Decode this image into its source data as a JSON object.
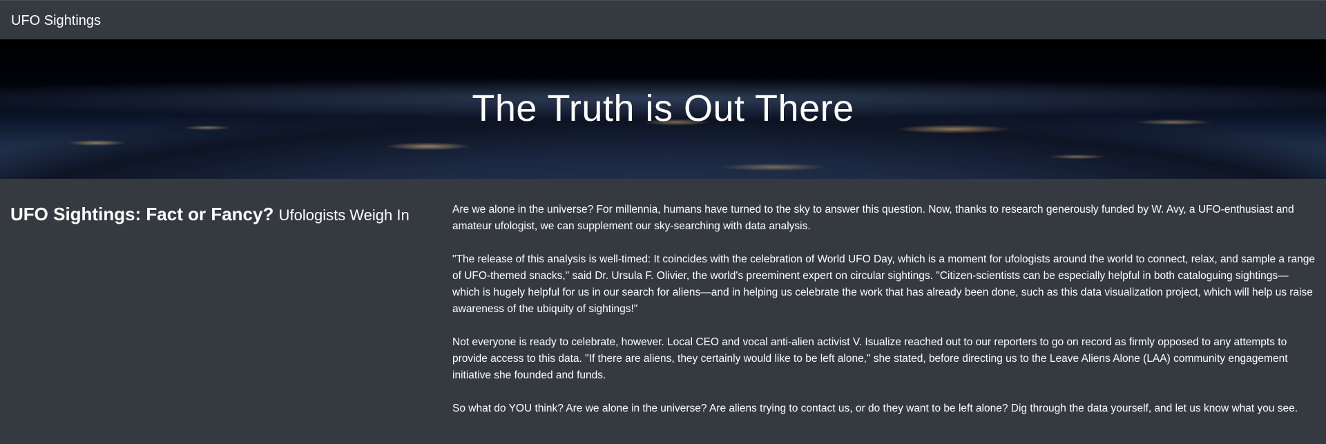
{
  "navbar": {
    "brand": "UFO Sightings"
  },
  "hero": {
    "title": "The Truth is Out There"
  },
  "article": {
    "headline": "UFO Sightings: Fact or Fancy?",
    "subheadline": "Ufologists Weigh In",
    "paragraphs": [
      "Are we alone in the universe? For millennia, humans have turned to the sky to answer this question. Now, thanks to research generously funded by W. Avy, a UFO-enthusiast and amateur ufologist, we can supplement our sky-searching with data analysis.",
      "\"The release of this analysis is well-timed: It coincides with the celebration of World UFO Day, which is a moment for ufologists around the world to connect, relax, and sample a range of UFO-themed snacks,\" said Dr. Ursula F. Olivier, the world's preeminent expert on circular sightings. \"Citizen-scientists can be especially helpful in both cataloguing sightings—which is hugely helpful for us in our search for aliens—and in helping us celebrate the work that has already been done, such as this data visualization project, which will help us raise awareness of the ubiquity of sightings!\"",
      "Not everyone is ready to celebrate, however. Local CEO and vocal anti-alien activist V. Isualize reached out to our reporters to go on record as firmly opposed to any attempts to provide access to this data. \"If there are aliens, they certainly would like to be left alone,\" she stated, before directing us to the Leave Aliens Alone (LAA) community engagement initiative she founded and funds.",
      "So what do YOU think? Are we alone in the universe? Are aliens trying to contact us, or do they want to be left alone? Dig through the data yourself, and let us know what you see."
    ]
  },
  "colors": {
    "background": "#343a40",
    "text": "#ffffff"
  }
}
